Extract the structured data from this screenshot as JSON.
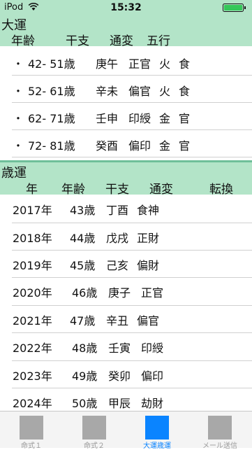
{
  "status_bar": {
    "carrier": "iPod",
    "time": "15:32"
  },
  "daiun": {
    "title": "大運",
    "headers": [
      "年齢",
      "干支",
      "通変",
      "五行"
    ],
    "rows": [
      {
        "bullet": "・",
        "age": "42- 51歳",
        "kanshi": "庚午",
        "tsuhen": "正官",
        "gogyo1": "火",
        "gogyo2": "食"
      },
      {
        "bullet": "・",
        "age": "52- 61歳",
        "kanshi": "辛未",
        "tsuhen": "偏官",
        "gogyo1": "火",
        "gogyo2": "食"
      },
      {
        "bullet": "・",
        "age": "62- 71歳",
        "kanshi": "壬申",
        "tsuhen": "印綬",
        "gogyo1": "金",
        "gogyo2": "官"
      },
      {
        "bullet": "・",
        "age": "72- 81歳",
        "kanshi": "癸酉",
        "tsuhen": "偏印",
        "gogyo1": "金",
        "gogyo2": "官"
      }
    ]
  },
  "saiun": {
    "title": "歳運",
    "headers": [
      "年",
      "年齢",
      "干支",
      "通変",
      "転換"
    ],
    "rows": [
      {
        "year": "2017年",
        "age": "43歳",
        "kanshi": "丁酉",
        "tsuhen": "食神"
      },
      {
        "year": "2018年",
        "age": "44歳",
        "kanshi": "戊戌",
        "tsuhen": "正財"
      },
      {
        "year": "2019年",
        "age": "45歳",
        "kanshi": "己亥",
        "tsuhen": "偏財"
      },
      {
        "year": "2020年",
        "age": "46歳",
        "kanshi": "庚子",
        "tsuhen": "正官"
      },
      {
        "year": "2021年",
        "age": "47歳",
        "kanshi": "辛丑",
        "tsuhen": "偏官"
      },
      {
        "year": "2022年",
        "age": "48歳",
        "kanshi": "壬寅",
        "tsuhen": "印綬"
      },
      {
        "year": "2023年",
        "age": "49歳",
        "kanshi": "癸卯",
        "tsuhen": "偏印"
      },
      {
        "year": "2024年",
        "age": "50歳",
        "kanshi": "甲辰",
        "tsuhen": "劫財"
      }
    ]
  },
  "tabs": [
    {
      "label": "命式１",
      "active": false
    },
    {
      "label": "命式２",
      "active": false
    },
    {
      "label": "大運歳運",
      "active": true
    },
    {
      "label": "メール送信",
      "active": false
    }
  ],
  "colors": {
    "header_bg": "#b3e4c8",
    "separator": "#6fbf9a",
    "active_tab": "#0a84ff"
  }
}
